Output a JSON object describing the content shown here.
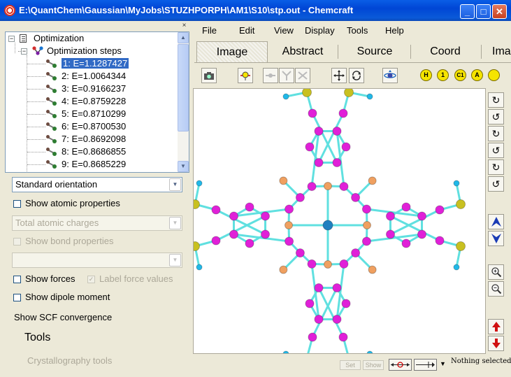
{
  "window": {
    "title": "E:\\QuantChem\\Gaussian\\MyJobs\\STUZHPORPH\\AM1\\S10\\stp.out - Chemcraft",
    "minimize": "_",
    "maximize": "□",
    "close": "✕"
  },
  "panel": {
    "close_glyph": "×"
  },
  "tree": {
    "root_label": "Optimization",
    "steps_label": "Optimization steps",
    "steps": [
      "1: E=1.1287427",
      "2: E=1.0064344",
      "3: E=0.9166237",
      "4: E=0.8759228",
      "5: E=0.8710299",
      "6: E=0.8700530",
      "7: E=0.8692098",
      "8: E=0.8686855",
      "9: E=0.8685229"
    ],
    "selected_index": 0
  },
  "left": {
    "orientation": "Standard orientation",
    "show_atomic_properties": "Show atomic properties",
    "atomic_charges": "Total atomic charges",
    "show_bond_properties": "Show bond properties",
    "empty_combo": "",
    "show_forces": "Show forces",
    "label_force_values": "Label force values",
    "label_force_values_checked": "✓",
    "show_dipole": "Show dipole moment",
    "show_scf": "Show SCF convergence",
    "tools": "Tools",
    "crystallography": "Crystallography tools"
  },
  "menu": [
    "File",
    "Edit",
    "View",
    "Display",
    "Tools",
    "Help"
  ],
  "tabs": [
    "Image",
    "Abstract",
    "Source",
    "Coord",
    "Ima"
  ],
  "active_tab": 0,
  "toolbar": {
    "h": "H",
    "one": "1",
    "c1": "C1",
    "a": "A",
    "arrow_glyph": "▼"
  },
  "status": {
    "set_label": "Set",
    "show_label": "Show",
    "text": "Nothing selected."
  },
  "colors": {
    "titlebar": "#0a5ee6",
    "selection": "#316ac5",
    "atom_c": "#e020d8",
    "atom_n": "#f0a060",
    "atom_s": "#c8c020",
    "atom_h": "#20b8e8",
    "atom_metal": "#2080c0",
    "bond": "#60e0e0"
  }
}
